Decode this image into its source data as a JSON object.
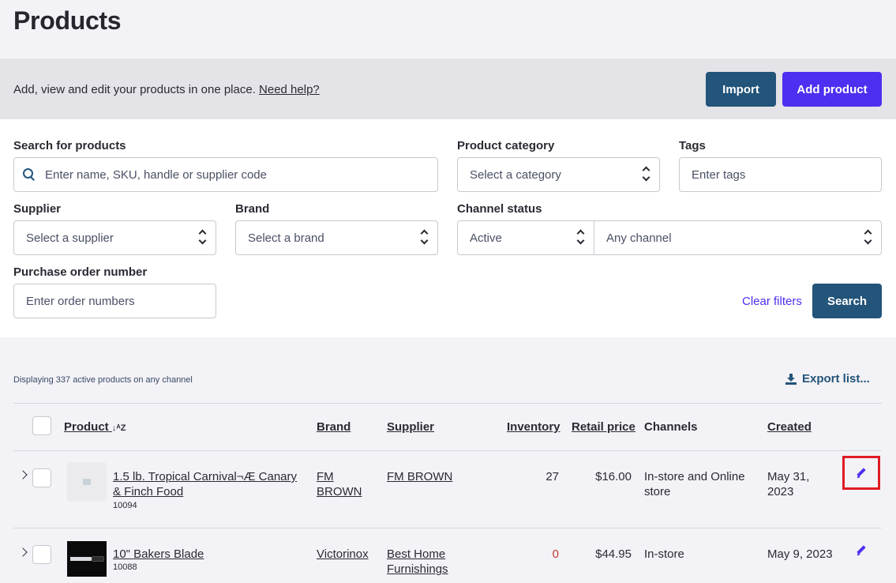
{
  "page": {
    "title": "Products"
  },
  "banner": {
    "text": "Add, view and edit your products in one place.",
    "help_link": "Need help?",
    "import_label": "Import",
    "add_label": "Add product"
  },
  "filters": {
    "search_label": "Search for products",
    "search_placeholder": "Enter name, SKU, handle or supplier code",
    "category_label": "Product category",
    "category_value": "Select a category",
    "tags_label": "Tags",
    "tags_placeholder": "Enter tags",
    "supplier_label": "Supplier",
    "supplier_value": "Select a supplier",
    "brand_label": "Brand",
    "brand_value": "Select a brand",
    "channel_status_label": "Channel status",
    "status_value": "Active",
    "channel_value": "Any channel",
    "po_label": "Purchase order number",
    "po_placeholder": "Enter order numbers",
    "clear_label": "Clear filters",
    "search_button": "Search"
  },
  "list": {
    "display_text": "Displaying 337 active products on any channel",
    "export_label": "Export list...",
    "headers": {
      "product": "Product",
      "sort_icon": "↓ᴬZ",
      "brand": "Brand",
      "supplier": "Supplier",
      "inventory": "Inventory",
      "retail_price": "Retail price",
      "channels": "Channels",
      "created": "Created"
    },
    "rows": [
      {
        "name_line1": "1.5 lb. Tropical Carnival¬Æ Canary",
        "name_line2": "& Finch Food",
        "sku": "10094",
        "brand_line1": "FM",
        "brand_line2": "BROWN",
        "supplier_line1": "FM BROWN",
        "supplier_line2": "",
        "inventory": "27",
        "price": "$16.00",
        "channels_line1": "In-store and Online",
        "channels_line2": "store",
        "created_line1": "May 31,",
        "created_line2": "2023"
      },
      {
        "name_line1": "10\" Bakers Blade",
        "name_line2": "",
        "sku": "10088",
        "brand_line1": "Victorinox",
        "brand_line2": "",
        "supplier_line1": "Best Home",
        "supplier_line2": "Furnishings",
        "inventory": "0",
        "price": "$44.95",
        "channels_line1": "In-store",
        "channels_line2": "",
        "created_line1": "May 9, 2023",
        "created_line2": ""
      }
    ]
  },
  "colors": {
    "primary": "#23547a",
    "accent": "#4c2ff0",
    "highlight": "#e01b24",
    "zero_inventory": "#c0392b"
  }
}
